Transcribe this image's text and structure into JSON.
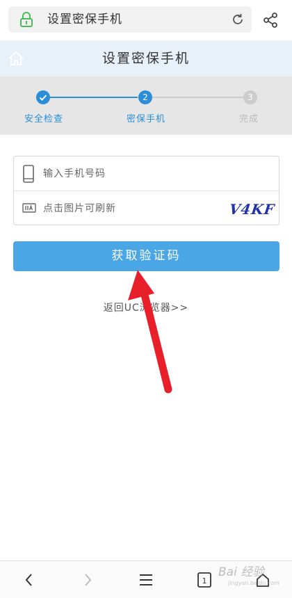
{
  "browser": {
    "url_text": "设置密保手机",
    "colors": {
      "lock": "#4cbb5b"
    }
  },
  "header": {
    "title": "设置密保手机",
    "background": "#e8f1fa"
  },
  "steps": [
    {
      "label": "安全检查",
      "number": "",
      "state": "done"
    },
    {
      "label": "密保手机",
      "number": "2",
      "state": "current"
    },
    {
      "label": "完成",
      "number": "3",
      "state": "pending"
    }
  ],
  "step_colors": {
    "active": "#2a8fd8",
    "inactive": "#cccccc",
    "pending_text": "#bbbbbb"
  },
  "form": {
    "phone_placeholder": "输入手机号码",
    "captcha_placeholder": "点击图片可刷新",
    "captcha_text": "V4KF"
  },
  "button": {
    "label": "获取验证码",
    "color": "#4ba6e6"
  },
  "back_link": "返回UC浏览器>>",
  "annotation": {
    "arrow_color": "#e8202a"
  },
  "watermark": {
    "main": "Bai 经验",
    "sub": "jingyan.baidu.com"
  },
  "toolbar": {
    "items": [
      "back-icon",
      "forward-icon",
      "menu-icon",
      "tabs-icon",
      "home-icon"
    ],
    "tabs_count": "1"
  }
}
